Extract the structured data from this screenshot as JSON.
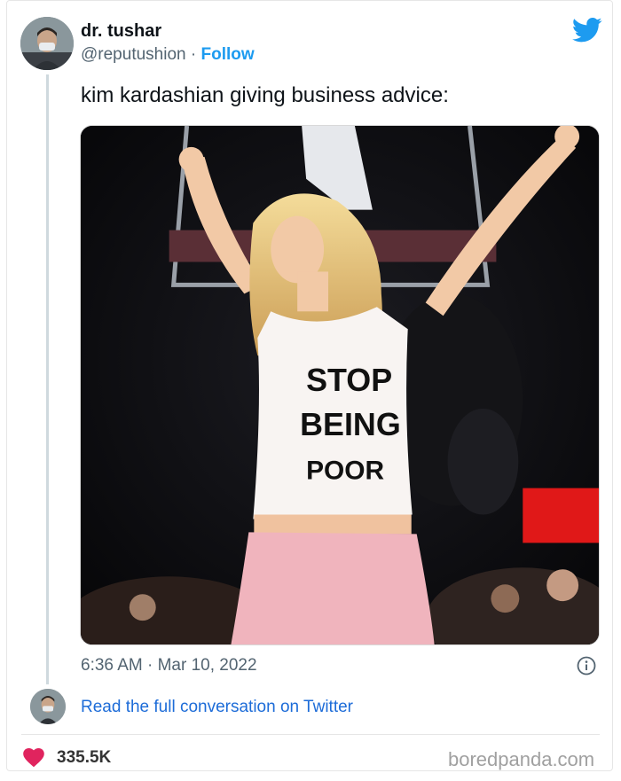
{
  "tweet": {
    "display_name": "dr. tushar",
    "handle": "@reputushion",
    "separator": " · ",
    "follow_label": "Follow",
    "text": "kim kardashian giving business advice:",
    "timestamp": "6:36 AM · Mar 10, 2022",
    "read_conversation_label": "Read the full conversation on Twitter",
    "like_count": "335.5K"
  },
  "photo": {
    "shirt_text": [
      "STOP",
      "BEING",
      "POOR"
    ]
  },
  "icons": {
    "brand": "twitter-bird-icon",
    "info": "info-icon",
    "like": "heart-icon"
  },
  "colors": {
    "link": "#1d9bf0",
    "twitter_blue": "#1d9bf0",
    "heart": "#e0245e",
    "muted_text": "#536471",
    "watermark": "#a0a0a0"
  },
  "watermark": "boredpanda.com"
}
